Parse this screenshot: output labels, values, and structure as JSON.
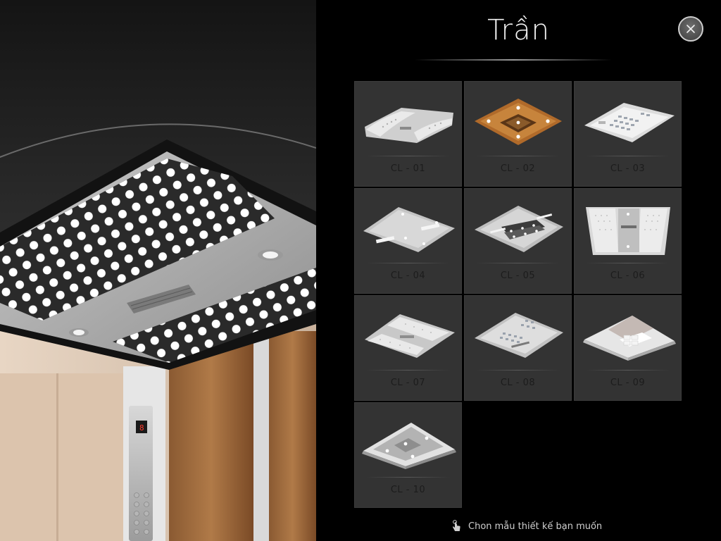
{
  "panel": {
    "title": "Trần",
    "close_icon": "close-icon",
    "hint_icon": "tap-hand-icon",
    "hint": "Chon mẫu thiết kế bạn muốn"
  },
  "preview": {
    "description_icon": "elevator-cabin-preview",
    "floor_display": "8"
  },
  "colors": {
    "tile_bg": "#333333",
    "panel_bg": "#000000",
    "label": "#1c1c1c",
    "title": "#f2f2f2"
  },
  "ceilings": [
    {
      "label": "CL - 01",
      "style": "wave-led"
    },
    {
      "label": "CL - 02",
      "style": "wood"
    },
    {
      "label": "CL - 03",
      "style": "white-grid"
    },
    {
      "label": "CL - 04",
      "style": "flat-silver"
    },
    {
      "label": "CL - 05",
      "style": "dark-strips"
    },
    {
      "label": "CL - 06",
      "style": "front-led"
    },
    {
      "label": "CL - 07",
      "style": "wave-led-2"
    },
    {
      "label": "CL - 08",
      "style": "steel-dots"
    },
    {
      "label": "CL - 09",
      "style": "white-glow"
    },
    {
      "label": "CL - 10",
      "style": "mirror"
    }
  ]
}
